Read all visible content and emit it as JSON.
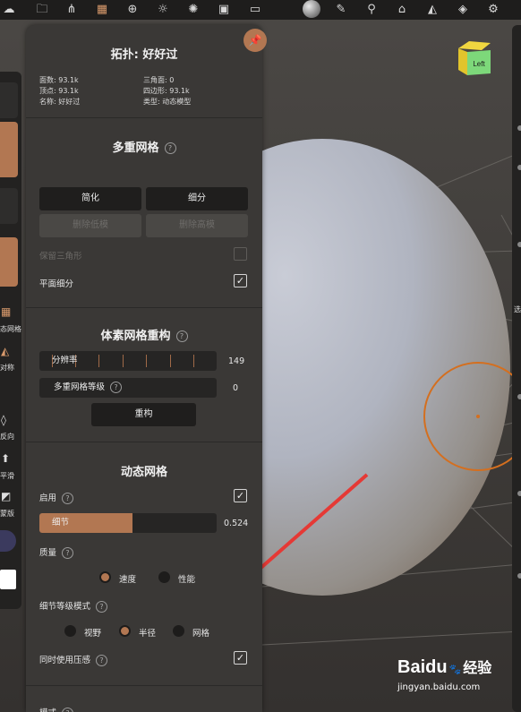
{
  "colors": {
    "accent": "#b27752",
    "panel": "#3a3836",
    "toolbar": "#1e1d1c",
    "arrow": "#e53935",
    "brush_ring": "#d46f1f"
  },
  "toolbar": {
    "icons": [
      "files-icon",
      "scene-tree-icon",
      "topology-grid-icon",
      "sphere-wire-icon",
      "light-icon",
      "material-icon",
      "image-icon",
      "video-icon",
      "matcap-sphere-icon",
      "brush-icon",
      "stamp-icon",
      "shoe-icon",
      "mirror-icon",
      "layers-icon",
      "settings-icon"
    ]
  },
  "left_strip": {
    "topology_label": "态网格",
    "symmetry_label": "对称",
    "invert_label": "反向",
    "smooth_label": "平滑",
    "mask_label": "蒙版"
  },
  "right_strip": {
    "label": "选"
  },
  "navcube": {
    "label": "Left"
  },
  "panel": {
    "title": "拓扑: 好好过",
    "info": {
      "faces": "面数: 93.1k",
      "triangles": "三角面: 0",
      "vertices": "顶点: 93.1k",
      "quads": "四边形: 93.1k",
      "name": "名称: 好好过",
      "type": "类型: 动态模型"
    },
    "multires": {
      "title": "多重网格",
      "help": "?",
      "reverse_button": "简化",
      "subdivide_button": "细分",
      "delete_lower_button": "删除低模",
      "delete_higher_button": "删除高模",
      "keep_triangles_label": "保留三角形",
      "keep_triangles_checked": false,
      "linear_subdiv_label": "平面细分",
      "linear_subdiv_checked": true
    },
    "voxel": {
      "title": "体素网格重构",
      "help": "?",
      "resolution_label": "分辨率",
      "resolution_value": "149",
      "multires_level_label": "多重网格等级",
      "multires_level_value": "0",
      "remesh_button": "重构"
    },
    "dyntopo": {
      "title": "动态网格",
      "enable_label": "启用",
      "enable_checked": true,
      "detail_label": "细节",
      "detail_value": "0.524",
      "detail_fraction": 0.524,
      "quality_label": "质量",
      "quality_options": [
        "速度",
        "性能"
      ],
      "quality_selected": 0,
      "lod_mode_label": "细节等级模式",
      "lod_options": [
        "视野",
        "半径",
        "网格"
      ],
      "lod_selected": 1,
      "pressure_label": "同时使用压感",
      "pressure_checked": true,
      "mode_label": "模式"
    }
  },
  "watermark": {
    "brand": "Baidu",
    "brand_cn": "经验",
    "url": "jingyan.baidu.com"
  }
}
